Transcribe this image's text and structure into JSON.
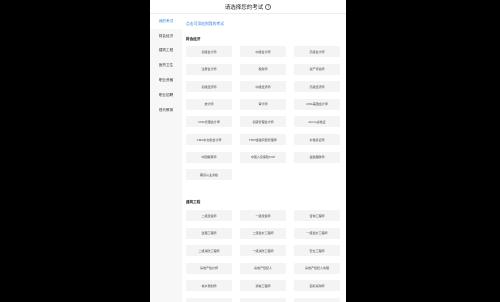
{
  "header": {
    "title": "请选择您的考试"
  },
  "sidebar": {
    "items": [
      {
        "label": "我的考试",
        "active": true
      },
      {
        "label": "财会经济"
      },
      {
        "label": "建筑工程"
      },
      {
        "label": "医药卫生"
      },
      {
        "label": "职业资格"
      },
      {
        "label": "职业招聘"
      },
      {
        "label": "现代教育"
      }
    ]
  },
  "main": {
    "add_note": "点击可添加到我的考试",
    "sections": [
      {
        "title": "财会经济",
        "items": [
          "初级会计师",
          "中级会计师",
          "高级会计师",
          "注册会计师",
          "税务师",
          "资产评估师",
          "初级经济师",
          "中级经济师",
          "高级经济师",
          "统计师",
          "审计师",
          "CMA美国会计师",
          "CMA管理会计师",
          "初级管理会计师",
          "ACCA资格证",
          "CMA中文版会计师",
          "FRM金融风险管理师",
          "价格鉴证师",
          "中国精算师",
          "中国人身保险CUE",
          "金融理财师",
          "期货从业资格"
        ]
      },
      {
        "title": "建筑工程",
        "items": [
          "二级建造师",
          "一级建造师",
          "咨询工程师",
          "监理工程师",
          "二级造价工程师",
          "一级造价工程师",
          "二级消防工程师",
          "一级消防工程师",
          "安全工程师",
          "房地产估价师",
          "房地产经纪人",
          "房地产经纪人协理",
          "城乡规划师",
          "通信工程师",
          "招标采购师",
          "注册测绘师",
          "环境影响评价师",
          "设备监理工程师"
        ]
      }
    ]
  }
}
